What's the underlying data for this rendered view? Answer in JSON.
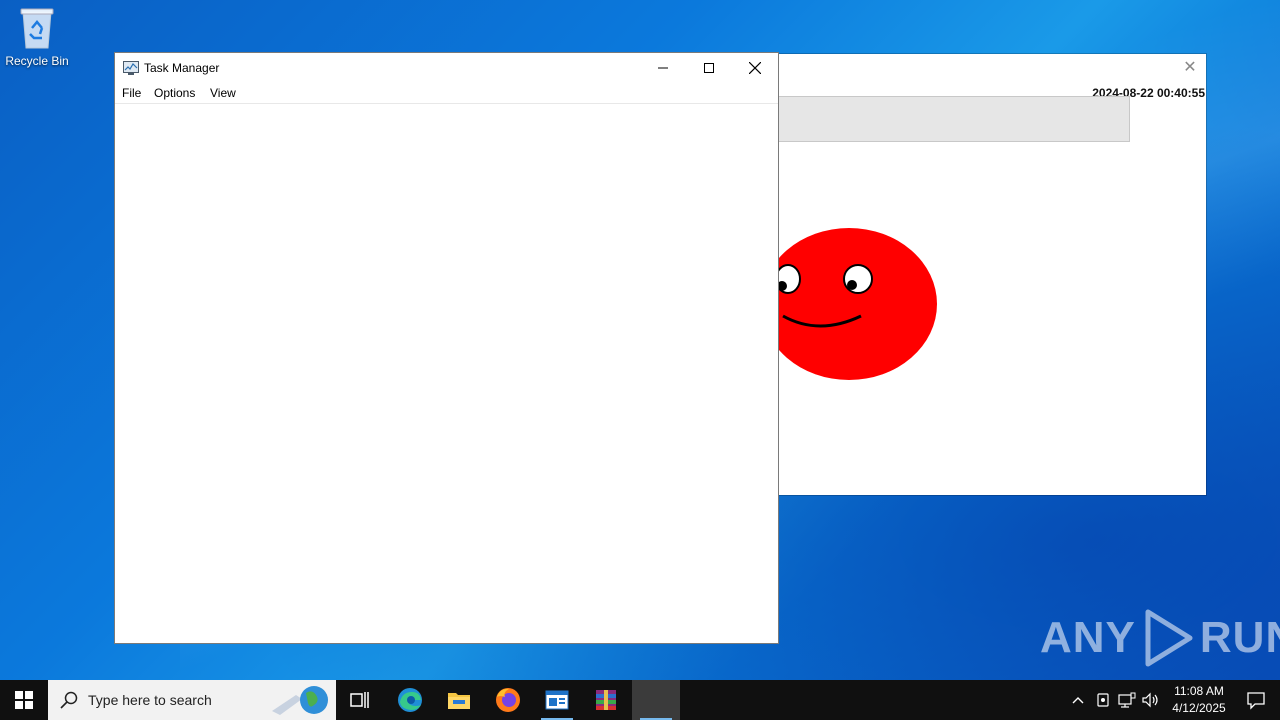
{
  "desktop": {
    "recycle_bin_label": "Recycle Bin"
  },
  "background_window": {
    "timestamp": "2024-08-22 00:40:55"
  },
  "task_manager": {
    "title": "Task Manager",
    "menu": [
      "File",
      "Options",
      "View"
    ]
  },
  "watermark": {
    "left": "ANY",
    "right": "RUN"
  },
  "taskbar": {
    "search_placeholder": "Type here to search",
    "time": "11:08 AM",
    "date": "4/12/2025",
    "apps": [
      "task-view",
      "edge",
      "file-explorer",
      "firefox",
      "prank-app",
      "winrar",
      "blank-app"
    ]
  },
  "colors": {
    "accent": "#0078d7",
    "face_red": "#ff0000",
    "taskbar": "#101010"
  }
}
